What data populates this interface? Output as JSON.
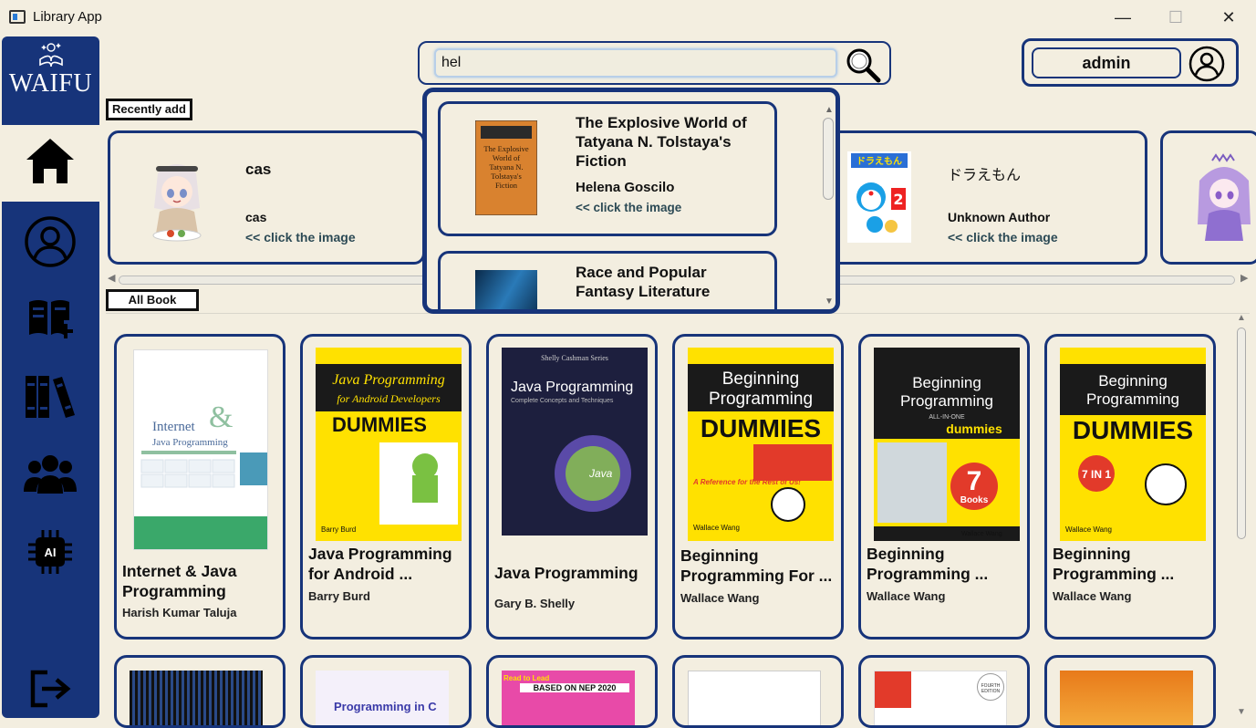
{
  "window": {
    "title": "Library App",
    "min": "—",
    "max": "☐",
    "close": "✕"
  },
  "sidebar": {
    "logo_text": "WAIFU"
  },
  "search": {
    "value": "hel",
    "placeholder": ""
  },
  "user": {
    "name": "admin"
  },
  "sections": {
    "recent": "Recently add",
    "all": "All Book"
  },
  "recent": [
    {
      "title": "cas",
      "author": "cas",
      "link": "<< click the image"
    },
    {
      "title": "ドラえもん",
      "author": "Unknown Author",
      "link": "<< click the image"
    }
  ],
  "dropdown": [
    {
      "title": "The Explosive World of Tatyana N. Tolstaya's Fiction",
      "author": "Helena Goscilo",
      "link": "<< click the image"
    },
    {
      "title": "Race and Popular Fantasy Literature",
      "author": "",
      "link": ""
    }
  ],
  "books": [
    {
      "title": "Internet & Java Programming",
      "author": "Harish Kumar Taluja"
    },
    {
      "title": "Java Programming for Android ...",
      "author": "Barry Burd"
    },
    {
      "title": "Java Programming",
      "author": "Gary B. Shelly"
    },
    {
      "title": "Beginning Programming For ...",
      "author": "Wallace Wang"
    },
    {
      "title": "Beginning Programming ...",
      "author": "Wallace Wang"
    },
    {
      "title": "Beginning Programming ...",
      "author": "Wallace Wang"
    }
  ],
  "covers": {
    "internet_java": {
      "main": "Internet",
      "amp": "&",
      "sub": "Java Programming"
    },
    "android": {
      "line1": "Java Programming",
      "line2": "for Android Developers",
      "brand": "DUMMIES",
      "author": "Barry Burd"
    },
    "java": {
      "series": "Shelly Cashman Series",
      "title": "Java Programming",
      "sub": "Complete Concepts and Techniques",
      "ball": "Java"
    },
    "beg1": {
      "line1": "Beginning",
      "line2": "Programming",
      "brand": "DUMMIES",
      "ref": "A Reference for the Rest of Us!",
      "author": "Wallace Wang"
    },
    "beg2": {
      "line1": "Beginning",
      "line2": "Programming",
      "sub": "ALL-IN-ONE",
      "brand": "dummies",
      "num": "7",
      "books": "Books",
      "author": "Wallace Wang"
    },
    "beg3": {
      "line1": "Beginning",
      "line2": "Programming",
      "brand": "DUMMIES",
      "badge": "7 IN 1",
      "author": "Wallace Wang"
    },
    "doraemon": {
      "title": "ドラえもん",
      "num": "2"
    },
    "tolstaya": {
      "text": "The Explosive World of Tatyana N. Tolstaya's Fiction"
    },
    "row2_c": {
      "text": "Programming in C"
    },
    "row2_nep": {
      "top": "Read to Lead",
      "band": "BASED ON NEP 2020"
    },
    "row2_ed": {
      "text": "FOURTH EDITION"
    }
  },
  "colors": {
    "navy": "#17347a",
    "cream": "#f3eee0",
    "yellow": "#ffe100"
  }
}
